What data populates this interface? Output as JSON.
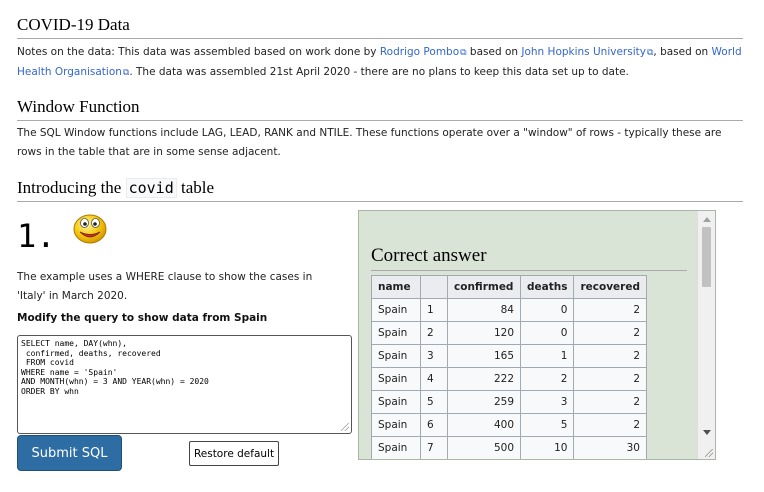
{
  "section1": {
    "title": "COVID-19 Data",
    "notes_prefix": "Notes on the data: This data was assembled based on work done by ",
    "link1": "Rodrigo Pombo",
    "notes_mid1": " based on ",
    "link2": "John Hopkins University",
    "notes_mid2": ", based on ",
    "link3": "World Health Organisation",
    "notes_suffix": ". The data was assembled 21st April 2020 - there are no plans to keep this data set up to date."
  },
  "section2": {
    "title": "Window Function",
    "text": "The SQL Window functions include LAG, LEAD, RANK and NTILE. These functions operate over a \"window\" of rows - typically these are rows in the table that are in some sense adjacent."
  },
  "section3": {
    "title_prefix": "Introducing the ",
    "title_code": "covid",
    "title_suffix": " table"
  },
  "question": {
    "number": "1.",
    "intro": "The example uses a WHERE clause to show the cases in 'Italy' in March 2020.",
    "task": "Modify the query to show data from Spain",
    "sql": "SELECT name, DAY(whn),\n confirmed, deaths, recovered\n FROM covid\nWHERE name = 'Spain'\nAND MONTH(whn) = 3 AND YEAR(whn) = 2020\nORDER BY whn",
    "submit_label": "Submit SQL",
    "restore_label": "Restore default"
  },
  "answer": {
    "title": "Correct answer",
    "headers": [
      "name",
      "",
      "confirmed",
      "deaths",
      "recovered"
    ],
    "rows": [
      [
        "Spain",
        "1",
        "84",
        "0",
        "2"
      ],
      [
        "Spain",
        "2",
        "120",
        "0",
        "2"
      ],
      [
        "Spain",
        "3",
        "165",
        "1",
        "2"
      ],
      [
        "Spain",
        "4",
        "222",
        "2",
        "2"
      ],
      [
        "Spain",
        "5",
        "259",
        "3",
        "2"
      ],
      [
        "Spain",
        "6",
        "400",
        "5",
        "2"
      ],
      [
        "Spain",
        "7",
        "500",
        "10",
        "30"
      ]
    ]
  },
  "colors": {
    "link": "#3366cc",
    "submit_bg": "#2e6da4",
    "answer_bg": "#d9e3d6"
  },
  "icons": {
    "smiley": "smiley-face-icon",
    "external_link": "external-link-icon"
  }
}
